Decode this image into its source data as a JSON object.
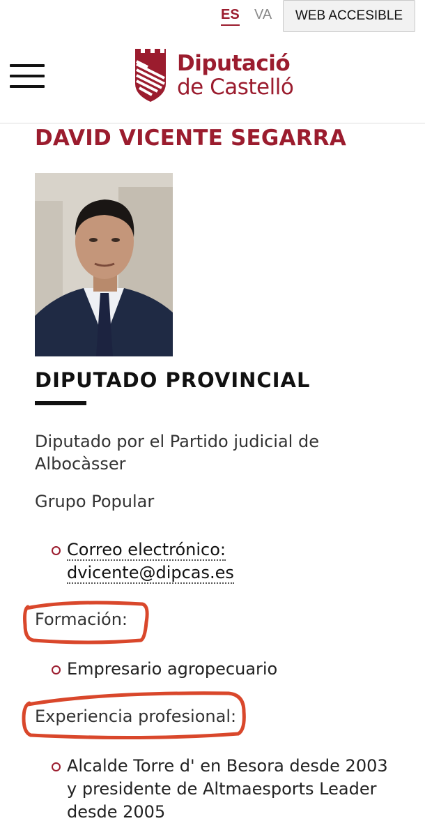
{
  "lang": {
    "es": "ES",
    "va": "VA",
    "accessible": "WEB ACCESIBLE"
  },
  "header": {
    "logo_line1": "Diputació",
    "logo_line2": "de Castelló"
  },
  "profile": {
    "name": "DAVID VICENTE SEGARRA",
    "role": "DIPUTADO PROVINCIAL",
    "description_line1": "Diputado por el Partido judicial de",
    "description_line2": "Albocàsser",
    "group": "Grupo Popular",
    "email_label": "Correo electrónico:",
    "email": "dvicente@dipcas.es"
  },
  "formacion": {
    "heading": "Formación:",
    "items": [
      "Empresario agropecuario"
    ]
  },
  "experiencia": {
    "heading": "Experiencia profesional:",
    "items": [
      {
        "line1": "Alcalde Torre d' en Besora desde 2003",
        "line2": "y presidente de Altmaesports Leader",
        "line3": "desde 2005"
      }
    ]
  },
  "colors": {
    "brand": "#9b1c2e",
    "annotation": "#d9472b"
  }
}
